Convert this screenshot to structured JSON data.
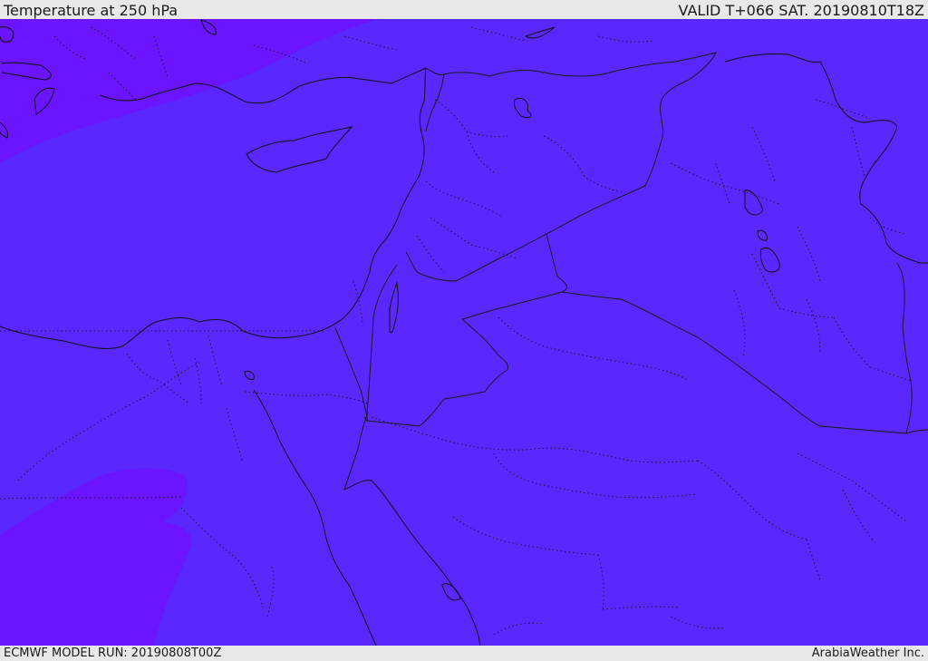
{
  "header": {
    "title": "Temperature at 250 hPa",
    "valid": "VALID T+066 SAT. 20190810T18Z"
  },
  "footer": {
    "model_run": "ECMWF MODEL RUN: 20190808T00Z",
    "credit": "ArabiaWeather Inc."
  },
  "map": {
    "colors": {
      "main_fill": "#5a28ff",
      "cold_fill": "#6a14ff",
      "coastline": "#111111",
      "border": "#1a1a1a"
    }
  }
}
